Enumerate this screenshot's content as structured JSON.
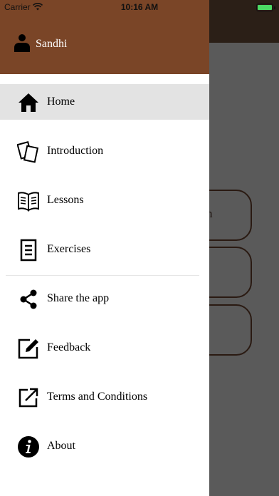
{
  "status_bar": {
    "carrier": "Carrier",
    "time": "10:16 AM"
  },
  "drawer": {
    "user_name": "Sandhi",
    "header_color": "#7a4527",
    "items": [
      {
        "label": "Home",
        "icon": "home-icon",
        "active": true
      },
      {
        "label": "Introduction",
        "icon": "cards-icon"
      },
      {
        "label": "Lessons",
        "icon": "book-icon"
      },
      {
        "label": "Exercises",
        "icon": "document-icon"
      },
      {
        "label": "Share the app",
        "icon": "share-icon"
      },
      {
        "label": "Feedback",
        "icon": "edit-icon"
      },
      {
        "label": "Terms and Conditions",
        "icon": "external-link-icon"
      },
      {
        "label": "About",
        "icon": "info-icon"
      }
    ]
  },
  "background": {
    "partial_button_text": "n"
  }
}
